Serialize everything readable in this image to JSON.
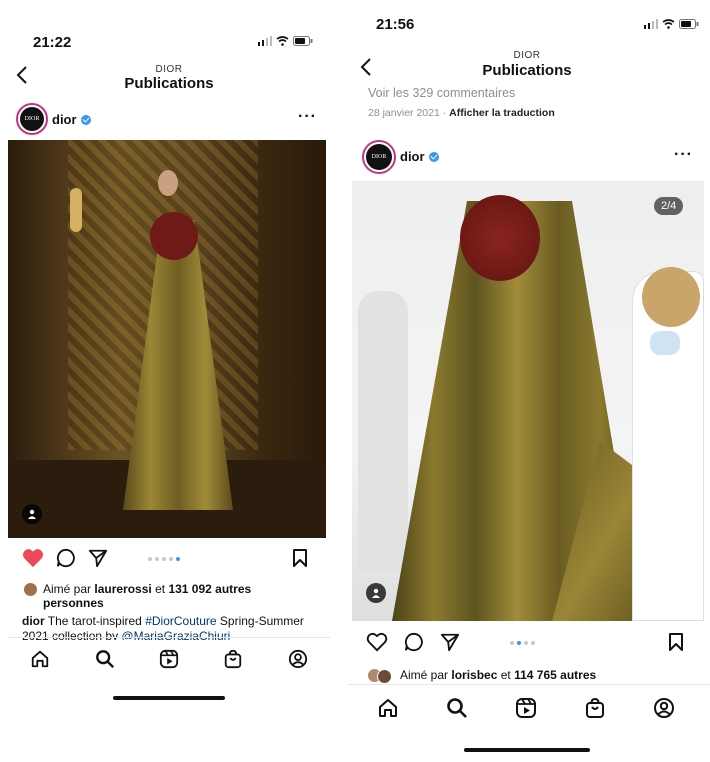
{
  "left": {
    "status_time": "21:22",
    "header_brand": "DIOR",
    "header_title": "Publications",
    "username": "dior",
    "more_menu": "···",
    "likes_prefix": "Aimé par",
    "likes_user": "laurerossi",
    "likes_middle": "et",
    "likes_count": "131 092 autres personnes",
    "caption_user": "dior",
    "caption_text1": "The tarot-inspired",
    "caption_hashtag": "#DiorCouture",
    "caption_text2": "Spring-Summer 2021 collection by",
    "caption_mention": "@MariaGraziaChiuri"
  },
  "right": {
    "status_time": "21:56",
    "header_brand": "DIOR",
    "header_title": "Publications",
    "view_comments": "Voir les 329 commentaires",
    "post_date": "28 janvier 2021",
    "date_sep": "·",
    "translate_link": "Afficher la traduction",
    "username": "dior",
    "more_menu": "···",
    "carousel_counter": "2/4",
    "likes_prefix": "Aimé par",
    "likes_user": "lorisbec",
    "likes_middle": "et",
    "likes_count": "114 765 autres"
  },
  "avatar_text": "DIOR",
  "colors": {
    "like_red": "#ed4956",
    "link_blue": "#00376b",
    "verified_blue": "#3897f0",
    "gold_dress": "#8a7a2e",
    "red_cape": "#6e1a17"
  },
  "icons": [
    "back-chevron",
    "heart",
    "comment",
    "share",
    "bookmark",
    "home",
    "search",
    "reels",
    "shop",
    "profile",
    "user-tag"
  ]
}
